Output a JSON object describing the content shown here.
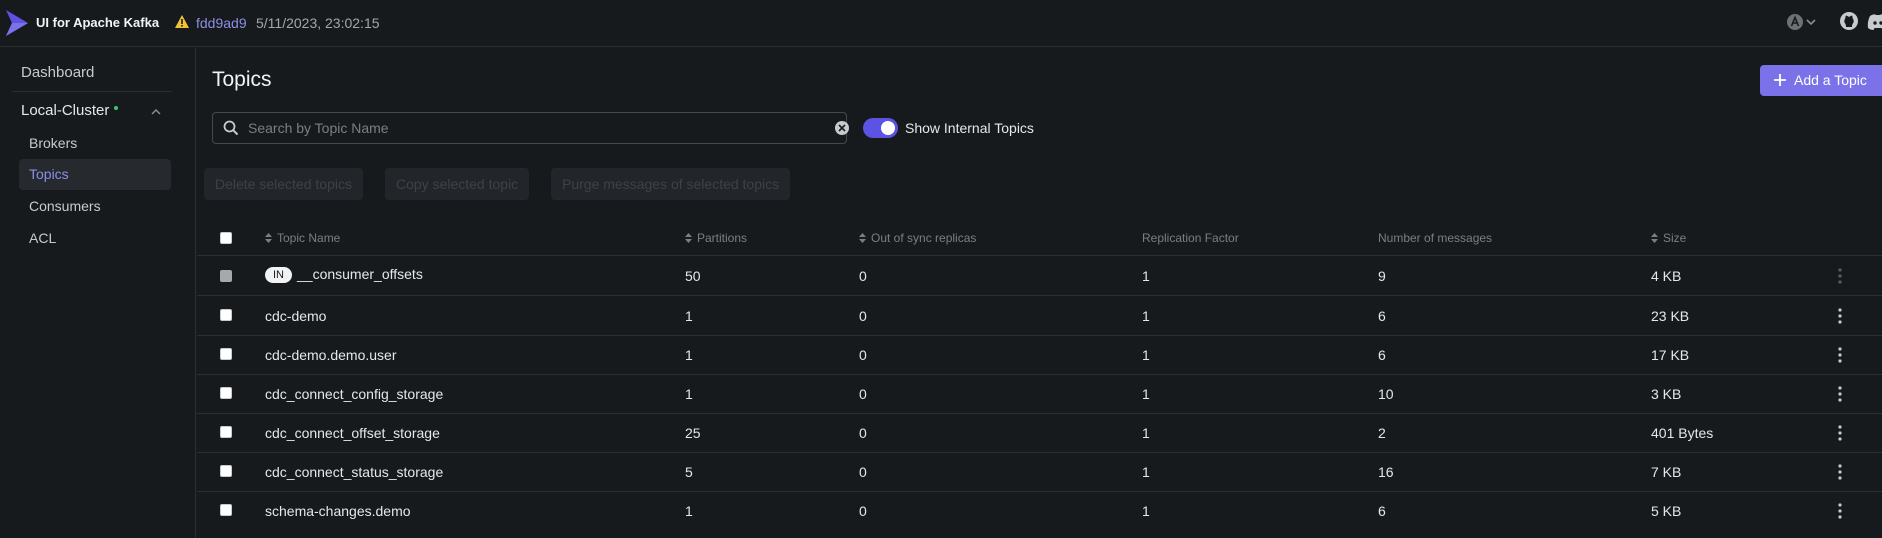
{
  "navbar": {
    "brand": "UI for Apache Kafka",
    "version": "fdd9ad9",
    "build_date": "5/11/2023, 23:02:15"
  },
  "sidebar": {
    "dashboard": "Dashboard",
    "cluster": "Local-Cluster",
    "items": [
      {
        "label": "Brokers",
        "active": false
      },
      {
        "label": "Topics",
        "active": true
      },
      {
        "label": "Consumers",
        "active": false
      },
      {
        "label": "ACL",
        "active": false
      }
    ]
  },
  "main": {
    "title": "Topics",
    "add_button": "Add a Topic",
    "search_placeholder": "Search by Topic Name",
    "search_value": "",
    "show_internal_label": "Show Internal Topics",
    "show_internal_enabled": true,
    "bulk_actions": [
      "Delete selected topics",
      "Copy selected topic",
      "Purge messages of selected topics"
    ]
  },
  "table": {
    "columns": [
      "Topic Name",
      "Partitions",
      "Out of sync replicas",
      "Replication Factor",
      "Number of messages",
      "Size"
    ],
    "internal_badge": "IN",
    "rows": [
      {
        "name": "__consumer_offsets",
        "internal": true,
        "partitions": "50",
        "out_of_sync": "0",
        "replication": "1",
        "messages": "9",
        "size": "4 KB"
      },
      {
        "name": "cdc-demo",
        "internal": false,
        "partitions": "1",
        "out_of_sync": "0",
        "replication": "1",
        "messages": "6",
        "size": "23 KB"
      },
      {
        "name": "cdc-demo.demo.user",
        "internal": false,
        "partitions": "1",
        "out_of_sync": "0",
        "replication": "1",
        "messages": "6",
        "size": "17 KB"
      },
      {
        "name": "cdc_connect_config_storage",
        "internal": false,
        "partitions": "1",
        "out_of_sync": "0",
        "replication": "1",
        "messages": "10",
        "size": "3 KB"
      },
      {
        "name": "cdc_connect_offset_storage",
        "internal": false,
        "partitions": "25",
        "out_of_sync": "0",
        "replication": "1",
        "messages": "2",
        "size": "401 Bytes"
      },
      {
        "name": "cdc_connect_status_storage",
        "internal": false,
        "partitions": "5",
        "out_of_sync": "0",
        "replication": "1",
        "messages": "16",
        "size": "7 KB"
      },
      {
        "name": "schema-changes.demo",
        "internal": false,
        "partitions": "1",
        "out_of_sync": "0",
        "replication": "1",
        "messages": "6",
        "size": "5 KB"
      }
    ]
  },
  "colors": {
    "accent": "#7b72e9",
    "background": "#171a1c",
    "status_online": "#3ec47f"
  },
  "icons": [
    "kafka-logo-icon",
    "warning-icon",
    "user-icon",
    "chevron-down-icon",
    "github-icon",
    "discord-icon",
    "search-icon",
    "clear-icon",
    "plus-icon",
    "sort-icon",
    "kebab-menu-icon"
  ]
}
